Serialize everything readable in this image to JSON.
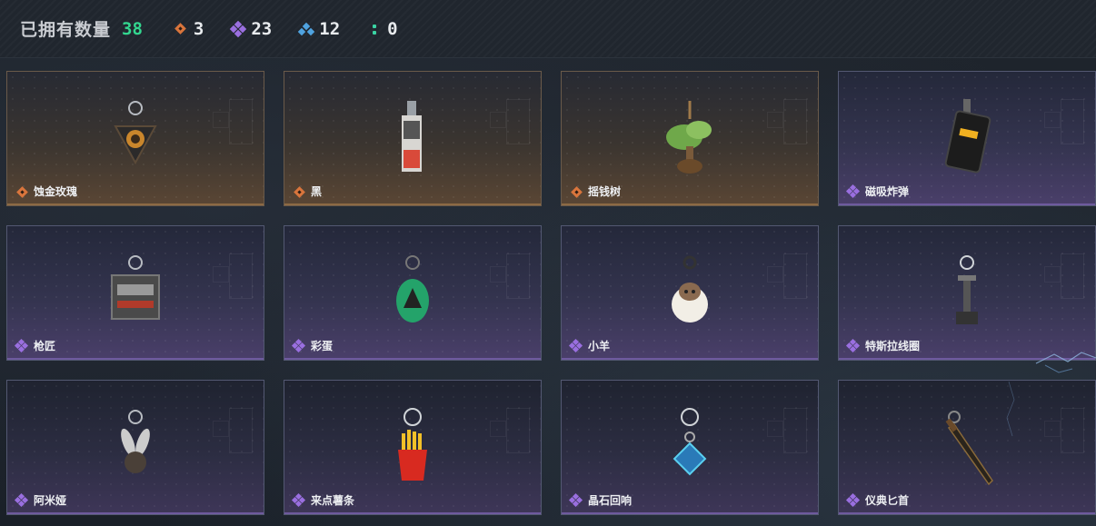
{
  "header": {
    "label": "已拥有数量",
    "total": "38",
    "stats": [
      {
        "icon": "orange-diamond-rarity-icon",
        "value": "3",
        "color": "#d9753c"
      },
      {
        "icon": "purple-diamond-rarity-icon",
        "value": "23",
        "color": "#9a6fe0"
      },
      {
        "icon": "blue-diamond-rarity-icon",
        "value": "12",
        "color": "#4fa3e0"
      },
      {
        "icon": "green-dots-rarity-icon",
        "value": "0",
        "color": "#3ad3a3"
      }
    ]
  },
  "items": [
    {
      "name": "蚀金玫瑰",
      "rarity": "orange",
      "icon": "rose-charm-icon"
    },
    {
      "name": "黑",
      "rarity": "orange",
      "icon": "card-charm-icon"
    },
    {
      "name": "摇钱树",
      "rarity": "orange",
      "icon": "money-tree-charm-icon"
    },
    {
      "name": "磁吸炸弹",
      "rarity": "purple",
      "icon": "bomb-charm-icon"
    },
    {
      "name": "枪匠",
      "rarity": "purple",
      "icon": "gunsmith-charm-icon"
    },
    {
      "name": "彩蛋",
      "rarity": "purple",
      "icon": "egg-charm-icon"
    },
    {
      "name": "小羊",
      "rarity": "purple",
      "icon": "sheep-charm-icon"
    },
    {
      "name": "特斯拉线圈",
      "rarity": "purple",
      "icon": "tesla-coil-charm-icon"
    },
    {
      "name": "阿米娅",
      "rarity": "purple",
      "icon": "amiya-charm-icon"
    },
    {
      "name": "来点薯条",
      "rarity": "purple",
      "icon": "fries-charm-icon"
    },
    {
      "name": "晶石回响",
      "rarity": "purple",
      "icon": "crystal-charm-icon"
    },
    {
      "name": "仪典匕首",
      "rarity": "purple",
      "icon": "dagger-charm-icon"
    }
  ]
}
